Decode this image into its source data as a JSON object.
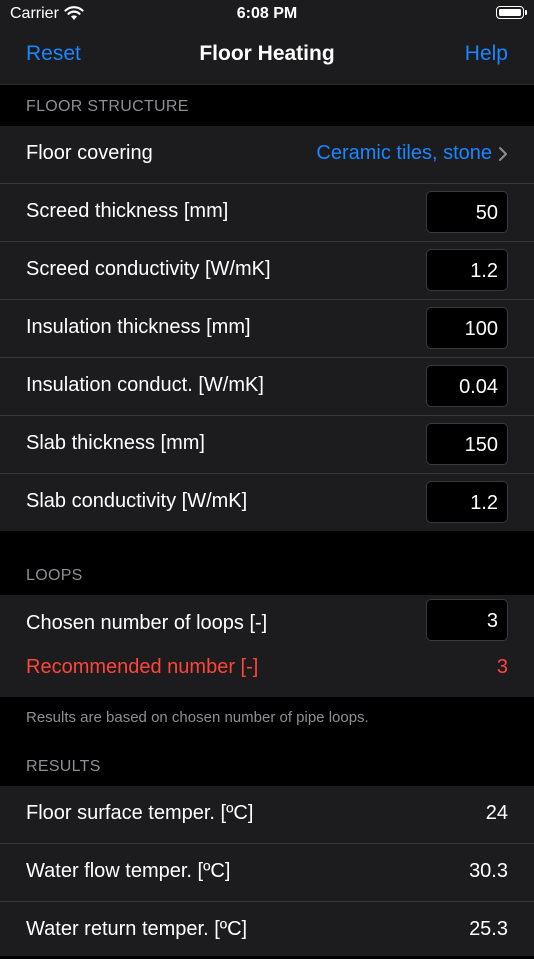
{
  "status": {
    "carrier": "Carrier",
    "time": "6:08 PM"
  },
  "nav": {
    "left": "Reset",
    "title": "Floor Heating",
    "right": "Help"
  },
  "floor": {
    "header": "FLOOR STRUCTURE",
    "covering_label": "Floor covering",
    "covering_value": "Ceramic tiles, stone",
    "rows": [
      {
        "label": "Screed thickness [mm]",
        "value": "50"
      },
      {
        "label": "Screed conductivity [W/mK]",
        "value": "1.2"
      },
      {
        "label": "Insulation thickness [mm]",
        "value": "100"
      },
      {
        "label": "Insulation conduct. [W/mK]",
        "value": "0.04"
      },
      {
        "label": "Slab thickness [mm]",
        "value": "150"
      },
      {
        "label": "Slab conductivity [W/mK]",
        "value": "1.2"
      }
    ]
  },
  "loops": {
    "header": "LOOPS",
    "chosen_label": "Chosen number of loops [-]",
    "chosen_value": "3",
    "recommended_label": "Recommended number [-]",
    "recommended_value": "3",
    "footnote": "Results are based on chosen number of pipe loops."
  },
  "results": {
    "header": "RESULTS",
    "rows": [
      {
        "label": "Floor surface temper. [ºC]",
        "value": "24"
      },
      {
        "label": "Water flow temper. [ºC]",
        "value": "30.3"
      },
      {
        "label": "Water return temper. [ºC]",
        "value": "25.3"
      }
    ]
  },
  "colors": {
    "accent": "#1a86ff",
    "warning": "#ff453a",
    "background": "#000000",
    "cell": "#1c1c1e"
  },
  "icons": {
    "wifi": "wifi-icon",
    "battery": "battery-icon",
    "chevron": "chevron-right-icon"
  }
}
